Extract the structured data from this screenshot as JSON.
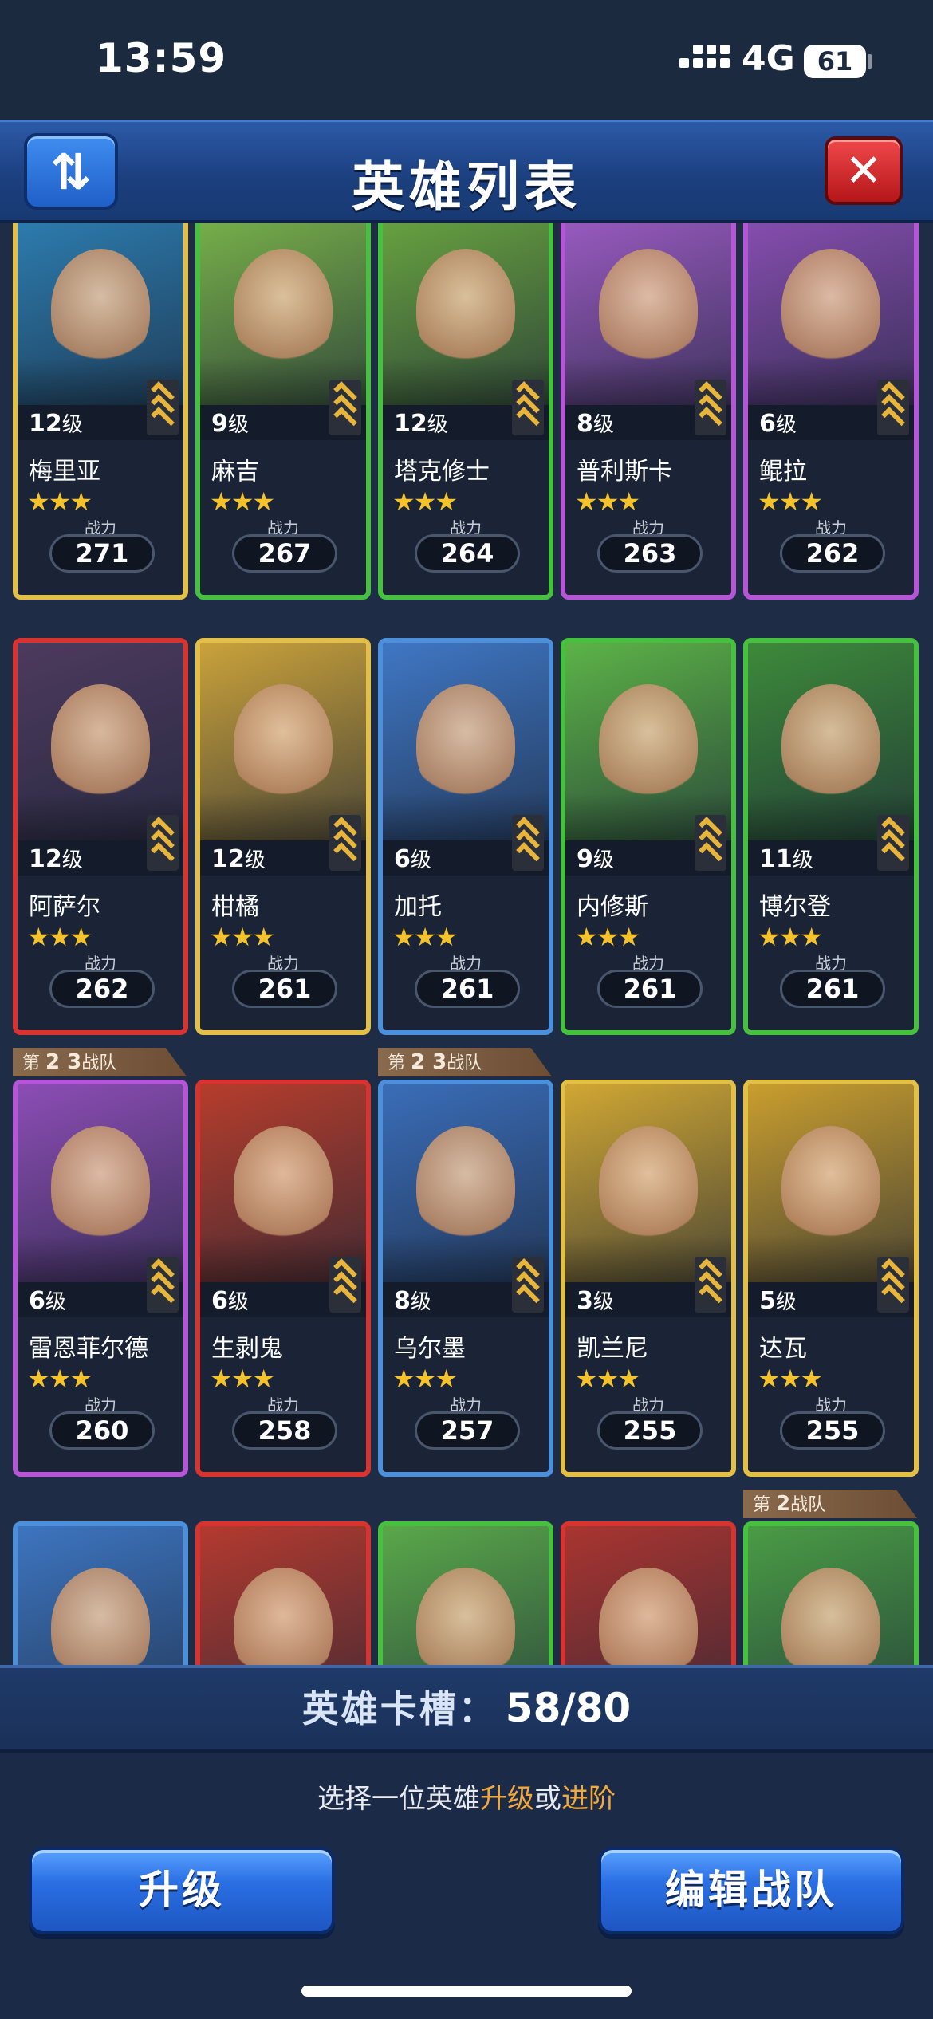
{
  "status": {
    "time": "13:59",
    "network": "4G",
    "battery": "61"
  },
  "header": {
    "title": "英雄列表",
    "sort_icon": "⇅",
    "close_icon": "✕"
  },
  "power_label": "战力",
  "level_suffix": "级",
  "star_text": "★★★",
  "heroes": [
    {
      "name": "梅里亚",
      "level": "12",
      "power": "271",
      "border": "gold",
      "bg": "#2d7fb3"
    },
    {
      "name": "麻吉",
      "level": "9",
      "power": "267",
      "border": "green",
      "bg": "#7ab44a"
    },
    {
      "name": "塔克修士",
      "level": "12",
      "power": "264",
      "border": "green",
      "bg": "#6aa640"
    },
    {
      "name": "普利斯卡",
      "level": "8",
      "power": "263",
      "border": "purple",
      "bg": "#9d5cc4"
    },
    {
      "name": "鲲拉",
      "level": "6",
      "power": "262",
      "border": "purple",
      "bg": "#8a4fb3"
    },
    {
      "name": "阿萨尔",
      "level": "12",
      "power": "262",
      "border": "red",
      "bg": "#4d3a5e"
    },
    {
      "name": "柑橘",
      "level": "12",
      "power": "261",
      "border": "gold",
      "bg": "#caa23a"
    },
    {
      "name": "加托",
      "level": "6",
      "power": "261",
      "border": "blue",
      "bg": "#3f77c4"
    },
    {
      "name": "内修斯",
      "level": "9",
      "power": "261",
      "border": "green",
      "bg": "#5cb347"
    },
    {
      "name": "博尔登",
      "level": "11",
      "power": "261",
      "border": "green",
      "bg": "#3d8a3a"
    },
    {
      "name": "雷恩菲尔德",
      "level": "6",
      "power": "260",
      "border": "purple",
      "bg": "#8c4db5"
    },
    {
      "name": "生剥鬼",
      "level": "6",
      "power": "258",
      "border": "red",
      "bg": "#b53d2c"
    },
    {
      "name": "乌尔墨",
      "level": "8",
      "power": "257",
      "border": "blue",
      "bg": "#3a6db8"
    },
    {
      "name": "凯兰尼",
      "level": "3",
      "power": "255",
      "border": "gold",
      "bg": "#d0a733"
    },
    {
      "name": "达瓦",
      "level": "5",
      "power": "255",
      "border": "gold",
      "bg": "#c99e2e"
    },
    {
      "name": "",
      "level": "",
      "power": "",
      "border": "blue",
      "bg": "#3d75c0"
    },
    {
      "name": "",
      "level": "",
      "power": "",
      "border": "red",
      "bg": "#b33a2f"
    },
    {
      "name": "",
      "level": "",
      "power": "",
      "border": "green",
      "bg": "#5aa84a"
    },
    {
      "name": "",
      "level": "",
      "power": "",
      "border": "red",
      "bg": "#a93530"
    },
    {
      "name": "",
      "level": "",
      "power": "",
      "border": "green",
      "bg": "#4a9c45"
    }
  ],
  "team_tags": [
    {
      "prefix": "第",
      "number": "2",
      "number2": "3",
      "suffix": "战队",
      "hero_index": 10
    },
    {
      "prefix": "第",
      "number": "2",
      "number2": "3",
      "suffix": "战队",
      "hero_index": 12
    },
    {
      "prefix": "第",
      "number": "2",
      "number2": "",
      "suffix": "战队",
      "hero_index": 19
    }
  ],
  "slots": {
    "label": "英雄卡槽：",
    "value": "58/80"
  },
  "hint": {
    "part1": "选择一位英雄",
    "highlight1": "升级",
    "part2": "或",
    "highlight2": "进阶"
  },
  "buttons": {
    "upgrade": "升级",
    "edit_team": "编辑战队"
  }
}
